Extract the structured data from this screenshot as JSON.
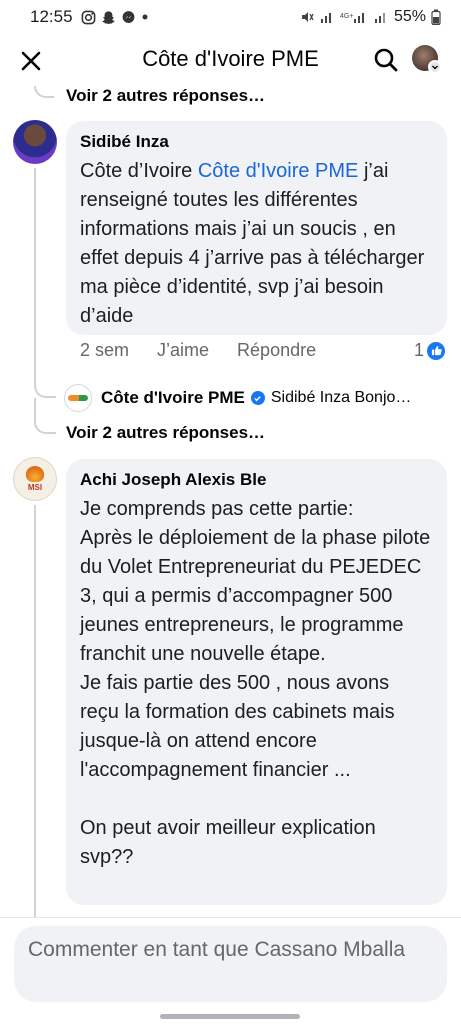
{
  "status_bar": {
    "time": "12:55",
    "battery": "55%",
    "icons": [
      "instagram-icon",
      "snapchat-icon",
      "facebook-messenger-icon",
      "dot-icon",
      "mute-icon",
      "wifi-icon",
      "4g-signal-icon",
      "signal-icon",
      "battery-icon"
    ]
  },
  "header": {
    "title": "Côte d'Ivoire PME"
  },
  "see_more_replies_1": "Voir 2 autres réponses…",
  "comment_1": {
    "author": "Sidibé Inza",
    "text_before_mention": "Côte d’Ivoire ",
    "mention": "Côte d'Ivoire PME",
    "text_after_mention": " j’ai renseigné toutes les différentes informations mais j’ai un soucis , en effet depuis 4 j’arrive pas à télécharger ma pièce d’identité, svp j’ai besoin d’aide",
    "time": "2 sem",
    "like_label": "J’aime",
    "reply_label": "Répondre",
    "reaction_count": "1"
  },
  "reply_preview": {
    "name": "Côte d'Ivoire PME",
    "snippet": "Sidibé Inza Bonjo…"
  },
  "see_more_replies_2": "Voir 2 autres réponses…",
  "comment_2": {
    "author": "Achi Joseph Alexis Ble",
    "avatar_text": "MSI",
    "text": "Je comprends pas cette partie:\nAprès le déploiement de la phase pilote du Volet Entrepreneuriat du PEJEDEC 3, qui a permis d’accompagner 500 jeunes entrepreneurs, le programme franchit une nouvelle étape.\nJe fais partie des 500 , nous avons reçu la formation des cabinets mais jusque-là on attend encore l'accompagnement financier ...\n\nOn peut avoir meilleur explication svp??"
  },
  "composer": {
    "placeholder": "Commenter en tant que Cassano Mballa"
  },
  "colors": {
    "link_blue": "#1c67d8",
    "bubble_gray": "#f0f2f5",
    "like_blue": "#1877f2"
  }
}
